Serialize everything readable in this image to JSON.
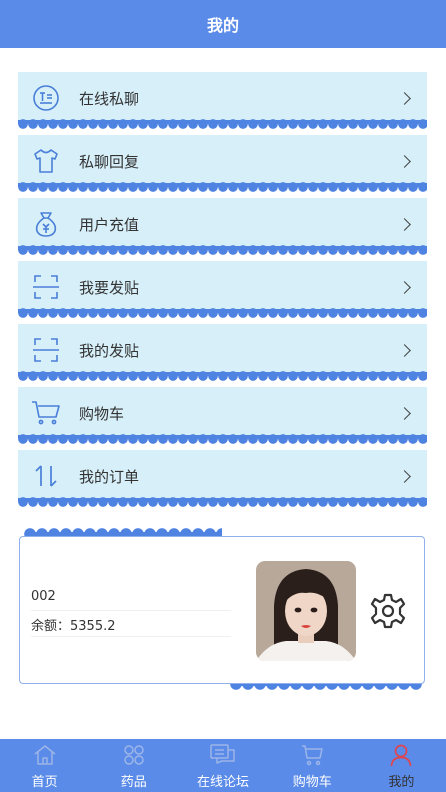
{
  "header": {
    "title": "我的"
  },
  "menu": [
    {
      "label": "在线私聊",
      "icon": "chat-list-icon"
    },
    {
      "label": "私聊回复",
      "icon": "tshirt-icon"
    },
    {
      "label": "用户充值",
      "icon": "money-bag-icon"
    },
    {
      "label": "我要发贴",
      "icon": "scan-frame-icon"
    },
    {
      "label": "我的发贴",
      "icon": "scan-frame-icon"
    },
    {
      "label": "购物车",
      "icon": "shopping-cart-icon"
    },
    {
      "label": "我的订单",
      "icon": "sort-arrows-icon"
    }
  ],
  "profile": {
    "id": "002",
    "balance": "余额：5355.2",
    "settings_icon": "gear-icon"
  },
  "tabbar": [
    {
      "label": "首页",
      "icon": "home-icon"
    },
    {
      "label": "药品",
      "icon": "clover-icon"
    },
    {
      "label": "在线论坛",
      "icon": "forum-icon"
    },
    {
      "label": "购物车",
      "icon": "cart-icon"
    },
    {
      "label": "我的",
      "icon": "user-icon",
      "active": true
    }
  ],
  "colors": {
    "primary": "#5a8be8",
    "menu_bg": "#d6eff9",
    "scallop": "#4f83e1",
    "icon_blue": "#4a7fd8",
    "active_icon": "#e0454e"
  }
}
